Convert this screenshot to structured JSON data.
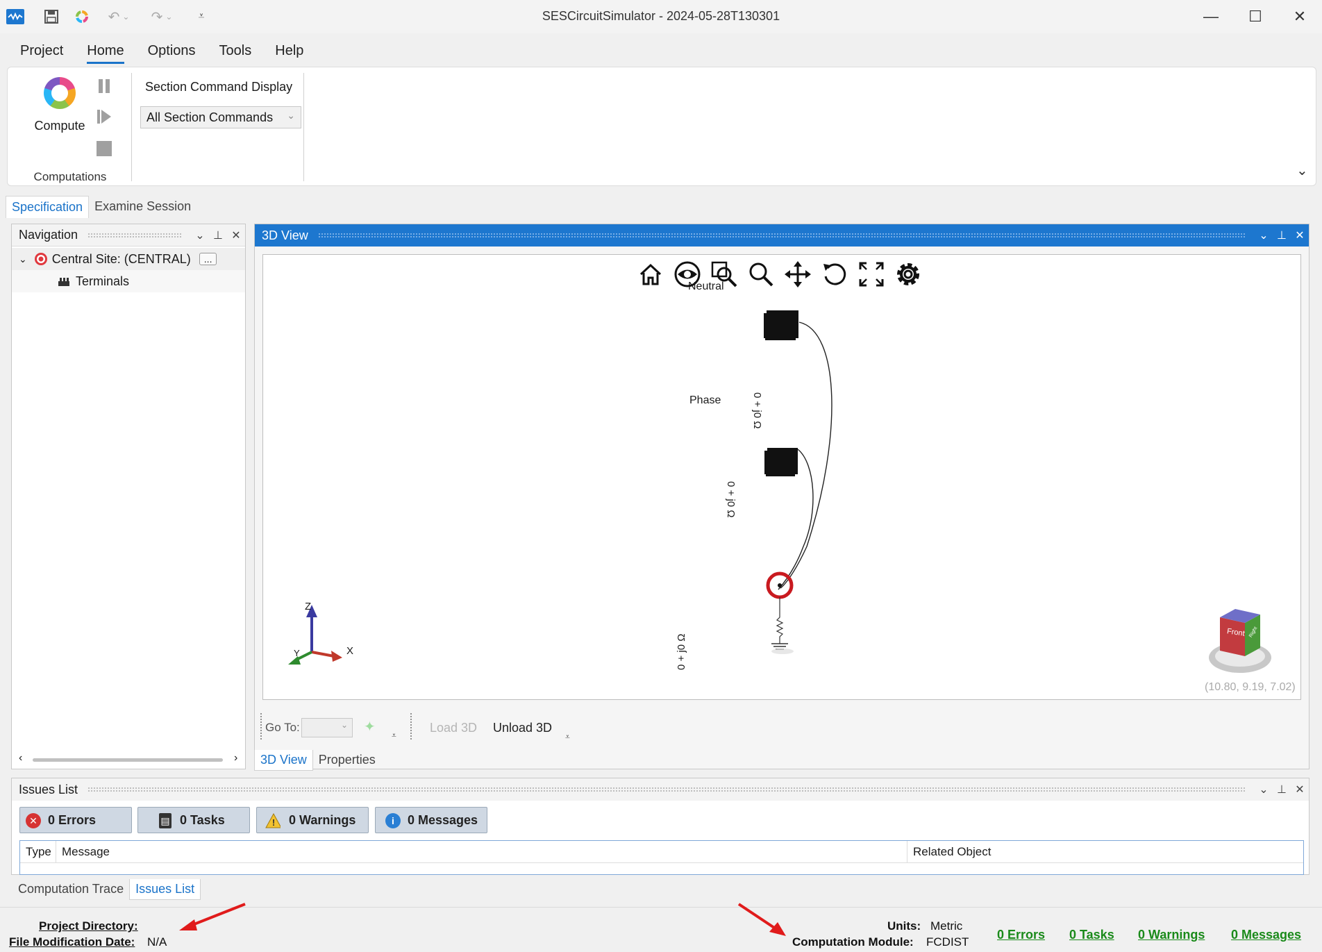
{
  "window": {
    "title": "SESCircuitSimulator - 2024-05-28T130301"
  },
  "menu": {
    "items": [
      "Project",
      "Home",
      "Options",
      "Tools",
      "Help"
    ],
    "active": "Home"
  },
  "ribbon": {
    "compute_label": "Compute",
    "group_label": "Computations",
    "section_command_display_label": "Section Command Display",
    "section_command_value": "All Section Commands"
  },
  "session_tabs": [
    "Specification",
    "Examine Session"
  ],
  "navigation": {
    "title": "Navigation",
    "site_label": "Central Site: (CENTRAL)",
    "more_label": "...",
    "child_label": "Terminals"
  },
  "view3d": {
    "title": "3D View",
    "labels": {
      "neutral": "Neutral",
      "phase": "Phase",
      "impedance": "0 + j0 Ω"
    },
    "axes": {
      "z": "Z",
      "x": "X",
      "y": "Y"
    },
    "cube": {
      "front": "Front",
      "right": "Right"
    },
    "coordinates": "(10.80, 9.19, 7.02)",
    "goto_label": "Go To:",
    "load_label": "Load 3D",
    "unload_label": "Unload 3D",
    "bottom_tabs": [
      "3D View",
      "Properties"
    ]
  },
  "issues": {
    "title": "Issues List",
    "buttons": {
      "errors": "0 Errors",
      "tasks": "0 Tasks",
      "warnings": "0 Warnings",
      "messages": "0 Messages"
    },
    "columns": [
      "Type",
      "Message",
      "Related Object"
    ],
    "bottom_tabs": [
      "Computation Trace",
      "Issues List"
    ]
  },
  "status": {
    "project_directory_label": "Project Directory:",
    "file_mod_label": "File Modification Date:",
    "file_mod_value": "N/A",
    "units_label": "Units:",
    "units_value": "Metric",
    "module_label": "Computation Module:",
    "module_value": "FCDIST",
    "links": {
      "errors": "0 Errors",
      "tasks": "0 Tasks",
      "warnings": "0 Warnings",
      "messages": "0 Messages"
    }
  },
  "colors": {
    "accent": "#1d77cf",
    "link_green": "#1a8a1a",
    "arrow_red": "#e01b1b"
  }
}
